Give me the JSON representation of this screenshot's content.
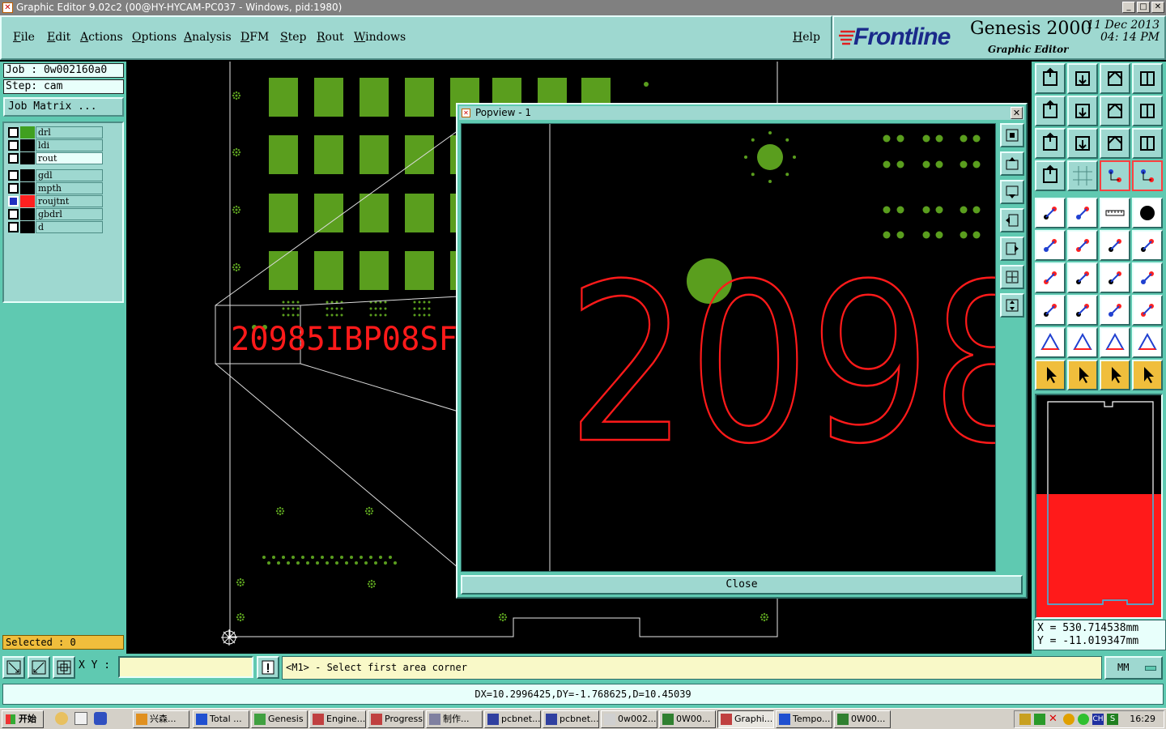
{
  "window": {
    "title": "Graphic Editor 9.02c2 (00@HY-HYCAM-PC037 - Windows, pid:1980)"
  },
  "menu": {
    "items": [
      "File",
      "Edit",
      "Actions",
      "Options",
      "Analysis",
      "DFM",
      "Step",
      "Rout",
      "Windows"
    ],
    "help": "Help"
  },
  "logo": {
    "brand": "Frontline",
    "product": "Genesis 2000",
    "subtitle": "Graphic Editor",
    "date": "11  Dec  2013",
    "time": "04: 14  PM"
  },
  "job": {
    "job_label": "Job  :  0w002160a0",
    "step_label": "Step:  cam",
    "matrix_button": "Job Matrix  ..."
  },
  "layers": [
    {
      "name": "drl",
      "color": "#40a020",
      "bg": "#9ed8d0",
      "checked": false
    },
    {
      "name": "ldi",
      "color": "#000000",
      "bg": "#9ed8d0",
      "checked": false
    },
    {
      "name": "rout",
      "color": "#000000",
      "bg": "#e8fffb",
      "checked": false
    },
    {
      "name": "gdl",
      "color": "#000000",
      "bg": "#9ed8d0",
      "checked": false
    },
    {
      "name": "mpth",
      "color": "#000000",
      "bg": "#9ed8d0",
      "checked": false
    },
    {
      "name": "roujtnt",
      "color": "#ff2020",
      "bg": "#9ed8d0",
      "checked": true
    },
    {
      "name": "gbdrl",
      "color": "#000000",
      "bg": "#9ed8d0",
      "checked": false
    },
    {
      "name": "d",
      "color": "#000000",
      "bg": "#9ed8d0",
      "checked": false
    }
  ],
  "selected": "Selected : 0",
  "canvas": {
    "board_text": "20985IBP08SF"
  },
  "popview": {
    "title": "Popview - 1",
    "zoom_text": "2098",
    "close_button": "Close"
  },
  "coords": {
    "x": "X  =  530.714538mm",
    "y": "Y  =  -11.019347mm"
  },
  "status": {
    "xy_label": "X Y :",
    "xy_value": "",
    "message": "<M1> - Select first area corner",
    "unit": "MM",
    "measure": "DX=10.2996425,DY=-1.768625,D=10.45039"
  },
  "taskbar": {
    "start": "开始",
    "tasks": [
      "兴森...",
      "Total ...",
      "Genesis",
      "Engine...",
      "Progress",
      "制作...",
      "pcbnet...",
      "pcbnet...",
      "0w002...",
      "0W00...",
      "Graphi...",
      "Tempo...",
      "0W00..."
    ],
    "time": "16:29",
    "lang": "CH"
  },
  "colors": {
    "teal": "#5fc9b1",
    "teal_light": "#9ed8d0",
    "pad_green": "#5a9e1e",
    "rout_red": "#ff1a1a"
  }
}
